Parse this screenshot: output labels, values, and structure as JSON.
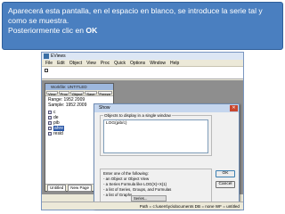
{
  "instruction": {
    "line1": "Aparecerá esta pantalla, en el espacio en blanco, se introduce la serie tal y como se muestra.",
    "line2_prefix": "Posteriormente clic en ",
    "line2_bold": "OK"
  },
  "app": {
    "title": "EViews",
    "menu": [
      "File",
      "Edit",
      "Object",
      "View",
      "Proc",
      "Quick",
      "Options",
      "Window",
      "Help"
    ]
  },
  "workfile": {
    "title": "Workfile: UNTITLED",
    "toolbar": [
      "View",
      "Proc",
      "Object",
      "Save",
      "Freeze",
      "Details+/-"
    ],
    "range": "Range:  1952 2009",
    "sample": "Sample: 1952 2009",
    "objects": [
      {
        "label": "c",
        "selected": false
      },
      {
        "label": "de",
        "selected": false
      },
      {
        "label": "pib",
        "selected": false
      },
      {
        "label": "ahre",
        "selected": true
      },
      {
        "label": "resid",
        "selected": false
      }
    ],
    "tabs": [
      "Untitled",
      "New Page"
    ]
  },
  "dialog": {
    "title": "Show",
    "group_label": "Objects to display in a single window",
    "input_value": "LOG(pib/c)",
    "ok_label": "OK",
    "cancel_label": "Cancel",
    "hint_lines": [
      "Enter one of the following:",
      " - an Object or Object View",
      " - a Series Formula like LOG(X)+X(1)",
      " - a list of Series, Groups, and Formulas",
      " - a list of Graphs"
    ]
  },
  "statusbar": {
    "path": "Path = c:\\users\\yo\\documents  DB = none  WF = untitled",
    "task": "Series..."
  },
  "colors": {
    "banner_bg": "#4a7fc0",
    "selection": "#2b58a8"
  }
}
